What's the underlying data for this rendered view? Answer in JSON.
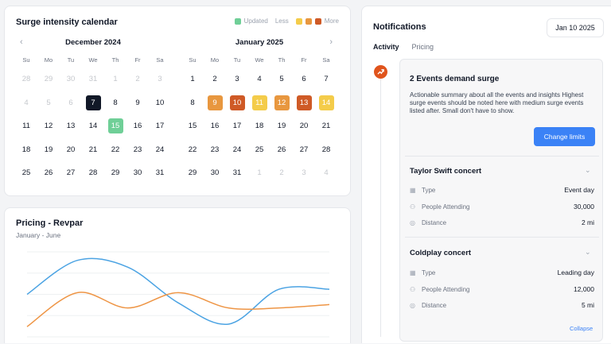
{
  "calendar": {
    "title": "Surge intensity calendar",
    "legend": {
      "updated": "Updated",
      "less": "Less",
      "more": "More"
    },
    "colors": {
      "updated": "#6fcf97",
      "today": "#111827",
      "heat": [
        "#f4cc4a",
        "#e8a44c",
        "#e07a3a",
        "#c9502a"
      ]
    },
    "weekdays": [
      "Su",
      "Mo",
      "Tu",
      "We",
      "Th",
      "Fr",
      "Sa"
    ],
    "prev_icon": "chevron-left-icon",
    "next_icon": "chevron-right-icon",
    "months": [
      {
        "name": "December 2024",
        "days": [
          {
            "d": "28",
            "muted": true
          },
          {
            "d": "29",
            "muted": true
          },
          {
            "d": "30",
            "muted": true
          },
          {
            "d": "31",
            "muted": true
          },
          {
            "d": "1",
            "muted": true
          },
          {
            "d": "2",
            "muted": true
          },
          {
            "d": "3",
            "muted": true
          },
          {
            "d": "4",
            "muted": true
          },
          {
            "d": "5",
            "muted": true
          },
          {
            "d": "6",
            "muted": true
          },
          {
            "d": "7",
            "state": "today"
          },
          {
            "d": "8"
          },
          {
            "d": "9"
          },
          {
            "d": "10"
          },
          {
            "d": "11"
          },
          {
            "d": "12"
          },
          {
            "d": "13"
          },
          {
            "d": "14"
          },
          {
            "d": "15",
            "state": "updated"
          },
          {
            "d": "16"
          },
          {
            "d": "17"
          },
          {
            "d": "18"
          },
          {
            "d": "19"
          },
          {
            "d": "20"
          },
          {
            "d": "21"
          },
          {
            "d": "22"
          },
          {
            "d": "23"
          },
          {
            "d": "24"
          },
          {
            "d": "25"
          },
          {
            "d": "26"
          },
          {
            "d": "27"
          },
          {
            "d": "28"
          },
          {
            "d": "29"
          },
          {
            "d": "30"
          },
          {
            "d": "31"
          }
        ]
      },
      {
        "name": "January 2025",
        "days": [
          {
            "d": "1"
          },
          {
            "d": "2"
          },
          {
            "d": "3"
          },
          {
            "d": "4"
          },
          {
            "d": "5"
          },
          {
            "d": "6"
          },
          {
            "d": "7"
          },
          {
            "d": "8"
          },
          {
            "d": "9",
            "heat": "#e8973f"
          },
          {
            "d": "10",
            "heat": "#cf5a26"
          },
          {
            "d": "11",
            "heat": "#f4cc4a"
          },
          {
            "d": "12",
            "heat": "#e8973f"
          },
          {
            "d": "13",
            "heat": "#cf5a26"
          },
          {
            "d": "14",
            "heat": "#f4cc4a"
          },
          {
            "d": "15"
          },
          {
            "d": "16"
          },
          {
            "d": "17"
          },
          {
            "d": "18"
          },
          {
            "d": "19"
          },
          {
            "d": "20"
          },
          {
            "d": "21"
          },
          {
            "d": "22"
          },
          {
            "d": "23"
          },
          {
            "d": "24"
          },
          {
            "d": "25"
          },
          {
            "d": "26"
          },
          {
            "d": "27"
          },
          {
            "d": "28"
          },
          {
            "d": "29"
          },
          {
            "d": "30"
          },
          {
            "d": "31"
          },
          {
            "d": "1",
            "muted": true
          },
          {
            "d": "2",
            "muted": true
          },
          {
            "d": "3",
            "muted": true
          },
          {
            "d": "4",
            "muted": true
          }
        ]
      }
    ]
  },
  "pricing": {
    "title": "Pricing - Revpar",
    "subtitle": "January - June"
  },
  "chart_data": {
    "type": "line",
    "title": "Pricing - Revpar",
    "subtitle": "January - June",
    "grid": true,
    "ylim": [
      0,
      100
    ],
    "x": [
      0,
      1,
      2,
      3,
      4,
      5,
      6
    ],
    "series": [
      {
        "color": "#4ba3e3",
        "values": [
          50,
          90,
          82,
          40,
          15,
          56,
          56
        ]
      },
      {
        "color": "#ee9545",
        "values": [
          12,
          52,
          34,
          52,
          34,
          34,
          38
        ]
      }
    ]
  },
  "notifications": {
    "title": "Notifications",
    "date": "Jan 10 2025",
    "tabs": [
      "Activity",
      "Pricing"
    ],
    "event": {
      "icon": "trend-up-icon",
      "title": "2 Events demand surge",
      "description": "Actionable summary about all the events and insights Highest surge events should be noted here with medium surge events listed after. Small don't have to show.",
      "button": "Change limits"
    },
    "items": [
      {
        "title": "Taylor Swift concert",
        "rows": [
          {
            "icon": "calendar-icon",
            "label": "Type",
            "value": "Event day"
          },
          {
            "icon": "people-icon",
            "label": "People Attending",
            "value": "30,000"
          },
          {
            "icon": "location-pin-icon",
            "label": "Distance",
            "value": "2 mi"
          }
        ]
      },
      {
        "title": "Coldplay concert",
        "rows": [
          {
            "icon": "calendar-icon",
            "label": "Type",
            "value": "Leading day"
          },
          {
            "icon": "people-icon",
            "label": "People Attending",
            "value": "12,000"
          },
          {
            "icon": "location-pin-icon",
            "label": "Distance",
            "value": "5 mi"
          }
        ]
      }
    ],
    "collapse": "Collapse"
  }
}
